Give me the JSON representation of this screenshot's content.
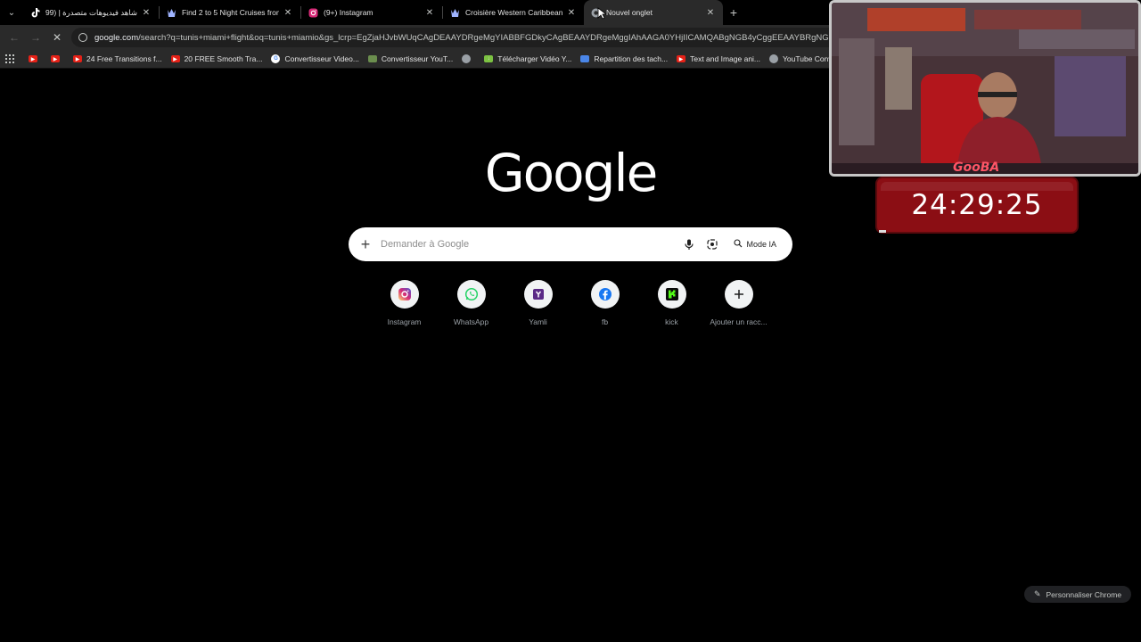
{
  "browser": {
    "tabs": [
      {
        "title": "شاهد فيديوهات متصدرة | (99+)",
        "favicon": "tiktok-icon",
        "active": false
      },
      {
        "title": "Find 2 to 5 Night Cruises from",
        "favicon": "royal-caribbean-icon",
        "active": false
      },
      {
        "title": "(9+) Instagram",
        "favicon": "instagram-icon",
        "active": false
      },
      {
        "title": "Croisière Western Caribbean &",
        "favicon": "royal-caribbean-icon",
        "active": false
      },
      {
        "title": "Nouvel onglet",
        "favicon": "chrome-icon",
        "active": true
      }
    ],
    "omnibox": {
      "url_host": "google.com",
      "url_path": "/search?q=tunis+miami+flight&oq=tunis+miamio&gs_lcrp=EgZjaHJvbWUqCAgDEAAYDRgeMgYIABBFGDkyCAgBEAAYDRgeMggIAhAAGA0YHjIICAMQABgNGB4yCggEEAAYBRgNGB4yCggF"
    },
    "bookmarks": [
      {
        "label": "",
        "icon": "youtube-icon"
      },
      {
        "label": "",
        "icon": "youtube-icon"
      },
      {
        "label": "24 Free Transitions f...",
        "icon": "youtube-icon"
      },
      {
        "label": "20 FREE Smooth Tra...",
        "icon": "youtube-icon"
      },
      {
        "label": "Convertisseur Video...",
        "icon": "google-icon"
      },
      {
        "label": "Convertisseur YouT...",
        "icon": "converter-icon"
      },
      {
        "label": "",
        "icon": "globe-icon"
      },
      {
        "label": "Télécharger Vidéo Y...",
        "icon": "download-icon"
      },
      {
        "label": "Repartition des tach...",
        "icon": "docs-icon"
      },
      {
        "label": "Text and Image ani...",
        "icon": "youtube-icon"
      },
      {
        "label": "YouTube Converter...",
        "icon": "globe-icon"
      }
    ]
  },
  "page": {
    "logo_text": "Google",
    "search": {
      "placeholder": "Demander à Google",
      "mode_label": "Mode IA"
    },
    "shortcuts": [
      {
        "label": "Instagram",
        "icon": "instagram-icon"
      },
      {
        "label": "WhatsApp",
        "icon": "whatsapp-icon"
      },
      {
        "label": "Yamli",
        "icon": "yamli-icon"
      },
      {
        "label": "fb",
        "icon": "facebook-icon"
      },
      {
        "label": "kick",
        "icon": "kick-icon"
      },
      {
        "label": "Ajouter un racc...",
        "icon": "plus-icon"
      }
    ],
    "customize_label": "Personnaliser Chrome"
  },
  "overlay": {
    "webcam_name": "GooBA",
    "timer": "24:29:25"
  },
  "colors": {
    "background": "#000000",
    "toolbar": "#2a2a2a",
    "timer_bg": "#8b0e14"
  }
}
